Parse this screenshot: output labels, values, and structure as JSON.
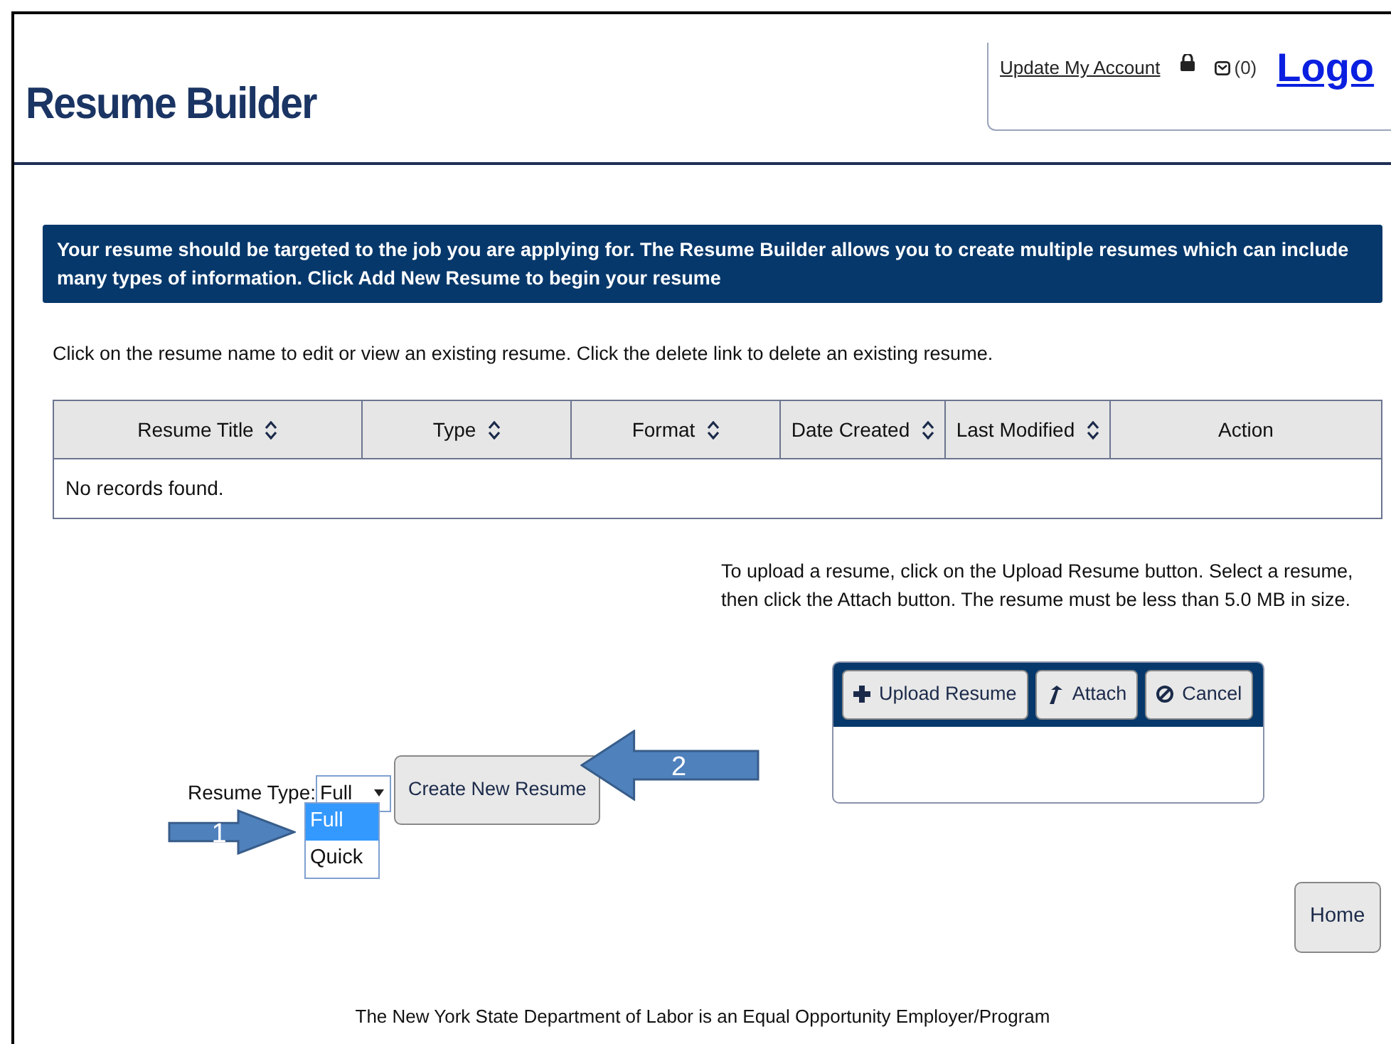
{
  "header": {
    "title": "Resume Builder",
    "account_link": "Update My Account",
    "messages_count": "(0)",
    "logout_link": "Logo"
  },
  "banner": {
    "text": "Your resume should be targeted to the job you are applying for. The Resume Builder allows you to create multiple resumes which can include many types of information. Click Add New Resume to begin your resume"
  },
  "instructions": "Click on the resume name to edit or view an existing resume. Click the delete link to delete an existing resume.",
  "table": {
    "columns": [
      {
        "label": "Resume Title",
        "sortable": true
      },
      {
        "label": "Type",
        "sortable": true
      },
      {
        "label": "Format",
        "sortable": true
      },
      {
        "label": "Date Created",
        "sortable": true
      },
      {
        "label": "Last Modified",
        "sortable": true
      },
      {
        "label": "Action",
        "sortable": false
      }
    ],
    "empty_message": "No records found."
  },
  "upload": {
    "help": "To upload a resume, click on the Upload Resume button. Select a resume, then click the Attach button. The resume must be less than 5.0 MB in size.",
    "buttons": [
      {
        "label": "Upload Resume",
        "kind": "plus"
      },
      {
        "label": "Attach",
        "kind": "attach"
      },
      {
        "label": "Cancel",
        "kind": "cancel"
      }
    ]
  },
  "resume_type": {
    "label": "Resume Type:",
    "value": "Full",
    "options": [
      {
        "label": "Full",
        "selected": true
      },
      {
        "label": "Quick",
        "selected": false
      }
    ]
  },
  "create_button": "Create New Resume",
  "annotations": [
    {
      "label": "1",
      "kind": "right"
    },
    {
      "label": "2",
      "kind": "left"
    }
  ],
  "home_button": "Home",
  "footer": "The New York State Department of Labor is an Equal Opportunity Employer/Program"
}
